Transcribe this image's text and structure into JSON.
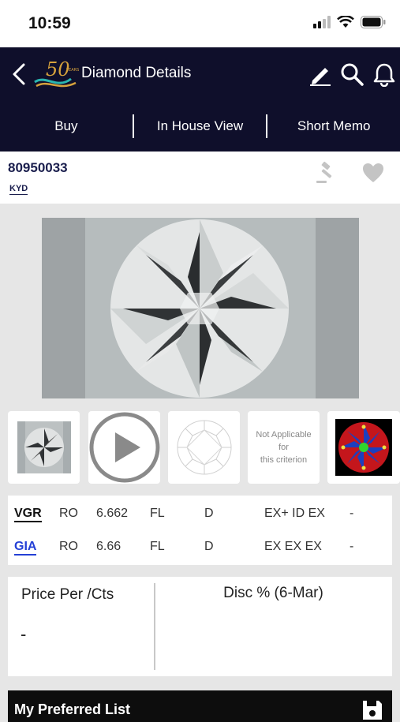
{
  "status_bar": {
    "time": "10:59"
  },
  "header": {
    "title": "Diamond Details",
    "logo_text": "50",
    "logo_small": "YEARS"
  },
  "tabs": [
    {
      "label": "Buy"
    },
    {
      "label": "In House View"
    },
    {
      "label": "Short Memo"
    }
  ],
  "stone": {
    "stock_no": "80950033",
    "vendor_code": "KYD"
  },
  "media": {
    "not_applicable_line1": "Not Applicable",
    "not_applicable_line2": "for",
    "not_applicable_line3": "this criterion"
  },
  "grades": [
    {
      "lab": "VGR",
      "shape": "RO",
      "weight": "6.662",
      "clarity": "FL",
      "color": "D",
      "cut": "EX+ ID EX",
      "extra": "-"
    },
    {
      "lab": "GIA",
      "shape": "RO",
      "weight": "6.66",
      "clarity": "FL",
      "color": "D",
      "cut": "EX EX EX",
      "extra": "-"
    }
  ],
  "pricing": {
    "price_label": "Price Per /Cts",
    "price_value": "-",
    "disc_label": "Disc % (6-Mar)"
  },
  "preferred": {
    "label": "My Preferred List"
  },
  "colors": {
    "header_bg": "#0f0f2b",
    "accent_navy": "#1a1e4d",
    "gia_link": "#2440d6"
  },
  "icons": [
    "back-icon",
    "pencil-icon",
    "search-icon",
    "bell-icon",
    "gavel-icon",
    "heart-icon",
    "play-icon",
    "save-icon"
  ]
}
